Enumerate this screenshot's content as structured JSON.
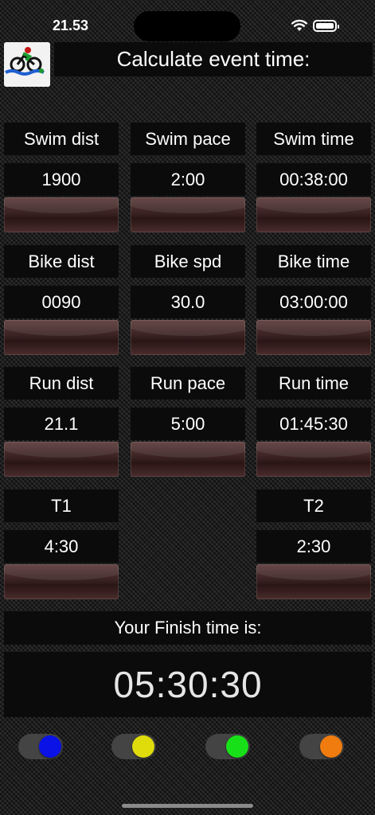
{
  "status_bar": {
    "time": "21.53"
  },
  "header": {
    "title": "Calculate event time:"
  },
  "swim": {
    "dist_label": "Swim dist",
    "pace_label": "Swim pace",
    "time_label": "Swim time",
    "dist_value": "1900",
    "pace_value": "2:00",
    "time_value": "00:38:00"
  },
  "bike": {
    "dist_label": "Bike dist",
    "spd_label": "Bike spd",
    "time_label": "Bike time",
    "dist_value": "0090",
    "spd_value": "30.0",
    "time_value": "03:00:00"
  },
  "run": {
    "dist_label": "Run dist",
    "pace_label": "Run pace",
    "time_label": "Run time",
    "dist_value": "21.1",
    "pace_value": "5:00",
    "time_value": "01:45:30"
  },
  "transitions": {
    "t1_label": "T1",
    "t1_value": "4:30",
    "t2_label": "T2",
    "t2_value": "2:30"
  },
  "finish": {
    "label": "Your Finish time is:",
    "value": "05:30:30"
  },
  "toggles": [
    {
      "name": "blue",
      "color": "#0a12e6",
      "on": true
    },
    {
      "name": "yellow",
      "color": "#e0dc0c",
      "on": true
    },
    {
      "name": "green",
      "color": "#18e018",
      "on": true
    },
    {
      "name": "orange",
      "color": "#f07c10",
      "on": true
    }
  ]
}
